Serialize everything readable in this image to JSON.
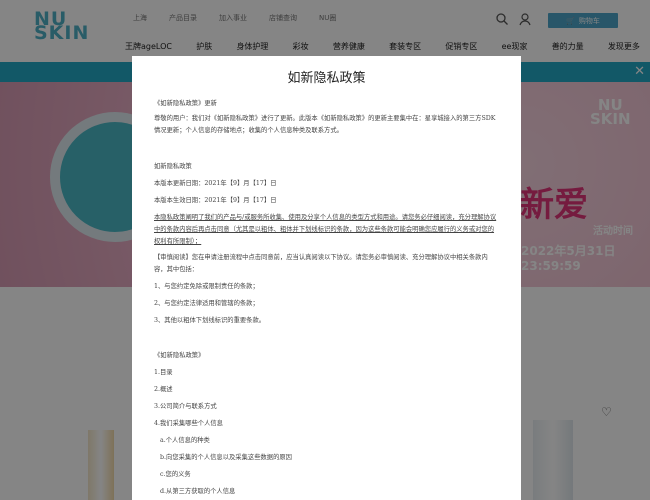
{
  "header": {
    "logo_top": "NU",
    "logo_bottom": "SKIN",
    "top_links": [
      "上海",
      "产品目录",
      "加入事业",
      "店铺查询",
      "NU圈"
    ],
    "cart_label": "购物车",
    "main_nav": [
      "王牌ageLOC",
      "护肤",
      "身体护理",
      "彩妆",
      "营养健康",
      "套装专区",
      "促销专区",
      "ee现家",
      "善的力量",
      "发现更多"
    ]
  },
  "hero": {
    "logo_top": "NU",
    "logo_bottom": "SKIN",
    "headline": "新爱",
    "activity_title": "活动时间",
    "activity_date": "2022年5月31日 23:59:59"
  },
  "modal": {
    "title": "如新隐私政策",
    "intro_heading": "《如新隐私政策》更新",
    "intro_text": "尊敬的用户：我们对《如新隐私政策》进行了更新。此版本《如新隐私政策》的更新主要集中在：星享城接入的第三方SDK情况更新；个人信息的存储地点；收集的个人信息种类及联系方式。",
    "policy_title": "如新隐私政策",
    "updated_date": "本版本更新日期：2021年【9】月【17】日",
    "effective_date": "本版本生效日期：2021年【9】月【17】日",
    "notice_underlined": "本隐私政策阐明了我们的产品与/或服务所收集、使用及分享个人信息的类型方式和用途。请您务必仔细阅读，充分理解协议中的条款内容后再点击同意（尤其是以粗体、粗体并下划线标识的条款，因为这些条款可能会明确您应履行的义务或对您的权利有所限制）；",
    "review_notice": "【审慎阅读】您在申请注册流程中点击同意前，应当认真阅读以下协议。请您务必审慎阅读、充分理解协议中相关条款内容，其中包括：",
    "review_items": [
      "1、与您约定免除或限制责任的条款；",
      "2、与您约定法律适用和管辖的条款；",
      "3、其他以粗体下划线标识的重要条款。"
    ],
    "toc_heading": "《如新隐私政策》",
    "toc": [
      "1.目录",
      "2.概述",
      "3.公司简介与联系方式",
      "4.我们采集哪些个人信息"
    ],
    "toc_sub": [
      "a.个人信息的种类",
      "b.向您采集的个人信息以及采集这些数据的原因",
      "c.您的义务",
      "d.从第三方获取的个人信息"
    ]
  },
  "colors": {
    "brand": "#4fb0c6",
    "banner": "#23a9c6",
    "cart": "#4ea6c9"
  }
}
